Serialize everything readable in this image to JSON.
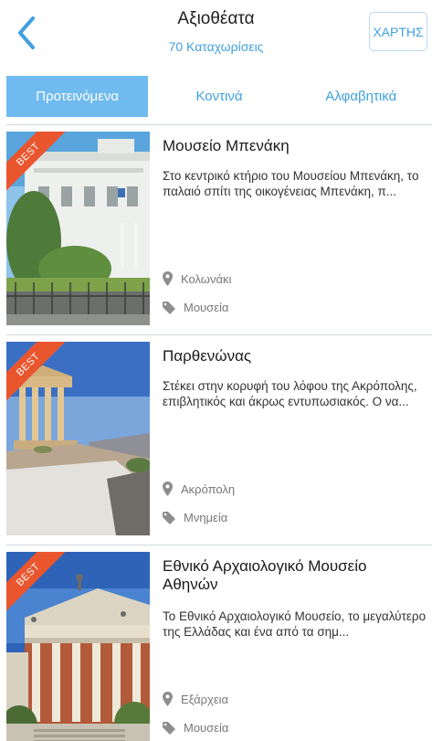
{
  "header": {
    "title": "Αξιοθέατα",
    "subtitle": "70 Καταχωρίσεις",
    "map_button": "ΧΑΡΤΗΣ",
    "back_icon": "chevron-left-icon"
  },
  "tabs": [
    {
      "label": "Προτεινόμενα",
      "active": true
    },
    {
      "label": "Κοντινά",
      "active": false
    },
    {
      "label": "Αλφαβητικά",
      "active": false
    }
  ],
  "items": [
    {
      "badge": "BEST",
      "title": "Μουσείο Μπενάκη",
      "description": "Στο κεντρικό κτήριο του Μουσείου Μπενάκη, το παλαιό σπίτι της οικογένειας Μπενάκη,  π...",
      "location": "Κολωνάκι",
      "category": "Μουσεία"
    },
    {
      "badge": "BEST",
      "title": "Παρθενώνας",
      "description": "Στέκει στην κορυφή του λόφου της Ακρόπολης, επιβλητικός και άκρως εντυπωσιακός.  Ο να...",
      "location": "Ακρόπολη",
      "category": "Μνημεία"
    },
    {
      "badge": "BEST",
      "title": "Εθνικό Αρχαιολογικό Μουσείο Αθηνών",
      "description": "Το Εθνικό Αρχαιολογικό Μουσείο, το μεγαλύτερο της Ελλάδας και ένα από τα σημ...",
      "location": "Εξάρχεια",
      "category": "Μουσεία"
    }
  ],
  "colors": {
    "accent": "#3fa0e0",
    "active_tab": "#6fbbef",
    "badge": "#e9552d"
  }
}
